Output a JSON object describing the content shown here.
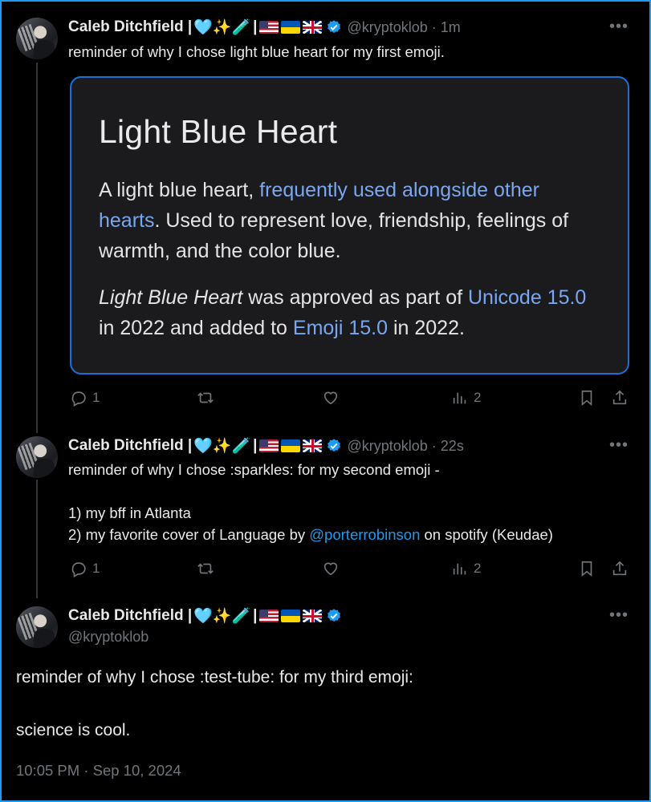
{
  "author": {
    "name": "Caleb Ditchfield |",
    "emojis": "🩵✨🧪",
    "separator": "|",
    "handle": "@kryptoklob"
  },
  "tweets": [
    {
      "time": "· 1m",
      "text": "reminder of why I chose light blue heart for my first emoji.",
      "card": {
        "title": "Light Blue Heart",
        "p1_a": "A light blue heart, ",
        "p1_link": "frequently used alongside other hearts",
        "p1_b": ". Used to represent love, friendship, feelings of warmth, and the color blue.",
        "p2_italic": "Light Blue Heart",
        "p2_a": " was approved as part of ",
        "p2_link1": "Unicode 15.0",
        "p2_b": " in 2022 and added to ",
        "p2_link2": "Emoji 15.0",
        "p2_c": " in 2022."
      },
      "replies": "1",
      "views": "2"
    },
    {
      "time": "· 22s",
      "text_a": "reminder of why I chose :sparkles: for my second emoji -\n\n1) my bff in Atlanta\n2) my favorite cover of Language by ",
      "mention": "@porterrobinson",
      "text_b": " on spotify (Keudae)",
      "replies": "1",
      "views": "2"
    },
    {
      "text": "reminder of why I chose :test-tube: for my third emoji:\n\nscience is cool.",
      "timestamp": "10:05 PM · Sep 10, 2024"
    }
  ],
  "icons": {
    "more": "more-icon",
    "reply": "reply-icon",
    "retweet": "retweet-icon",
    "like": "heart-icon",
    "views": "views-icon",
    "bookmark": "bookmark-icon",
    "share": "share-icon",
    "verified": "verified-badge-icon"
  },
  "colors": {
    "accent": "#1d9bf0",
    "muted": "#71767b",
    "background": "#000000"
  }
}
